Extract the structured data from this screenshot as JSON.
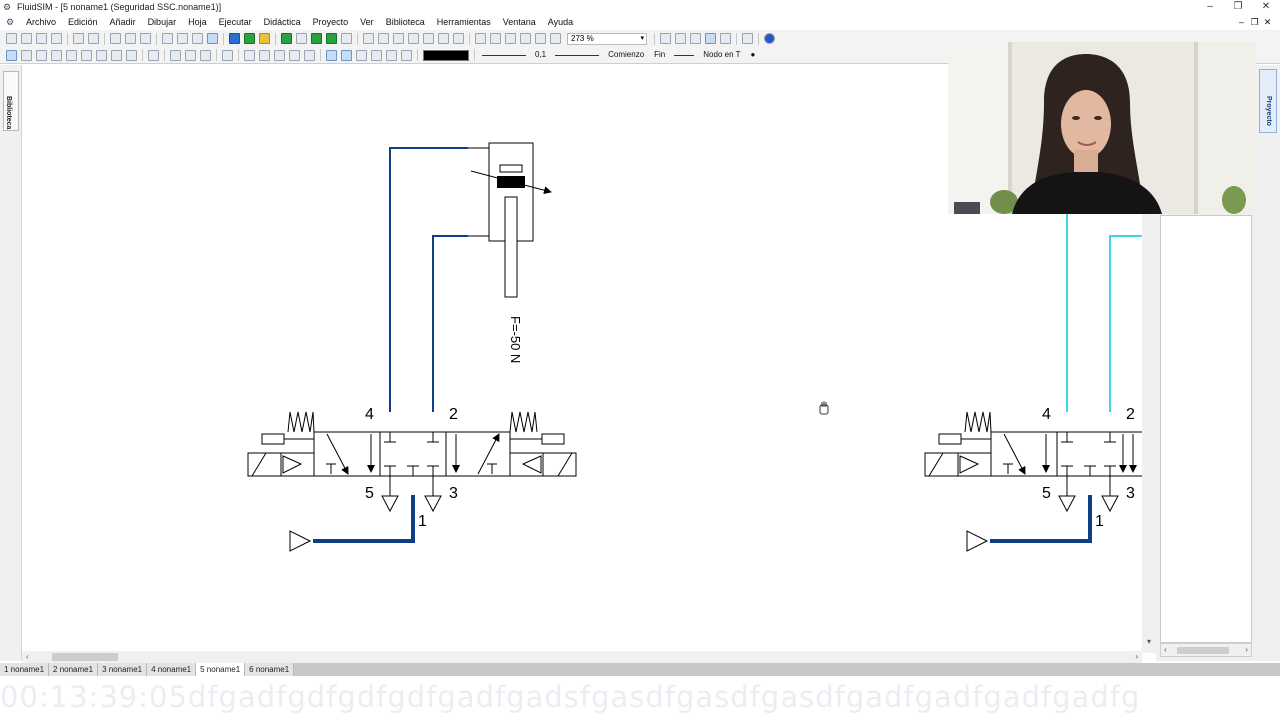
{
  "window": {
    "title": "FluidSIM - [5  noname1 (Seguridad SSC.noname1)]"
  },
  "menu": {
    "items": [
      "Archivo",
      "Edición",
      "Añadir",
      "Dibujar",
      "Hoja",
      "Ejecutar",
      "Didáctica",
      "Proyecto",
      "Ver",
      "Biblioteca",
      "Herramientas",
      "Ventana",
      "Ayuda"
    ]
  },
  "toolbar": {
    "zoom": "273 %",
    "line_width": "0,1",
    "line_start": "Comienzo",
    "line_end": "Fin",
    "node": "Nodo en T"
  },
  "docks": {
    "left": "Biblioteca",
    "right": "Proyecto"
  },
  "diagram": {
    "cylinder_force_label": "F=-50 N",
    "valve_left": {
      "port_4": "4",
      "port_2": "2",
      "port_5": "5",
      "port_3": "3",
      "port_1": "1"
    },
    "valve_right": {
      "port_4": "4",
      "port_2": "2",
      "port_5": "5",
      "port_3": "3",
      "port_1": "1"
    },
    "colors": {
      "line_idle": "#0d3f86",
      "line_active": "#3ad6e6",
      "symbol": "#000000"
    }
  },
  "sheet_tabs": [
    "1 noname1",
    "2 noname1",
    "3 noname1",
    "4 noname1",
    "5 noname1",
    "6 noname1"
  ],
  "active_tab_index": 4,
  "overlay_text": "00:13:39:05dfgadfgdfgdfgdfgadfgadsfgasdfgasdfgasdfgadfgadfgadfgadfg"
}
